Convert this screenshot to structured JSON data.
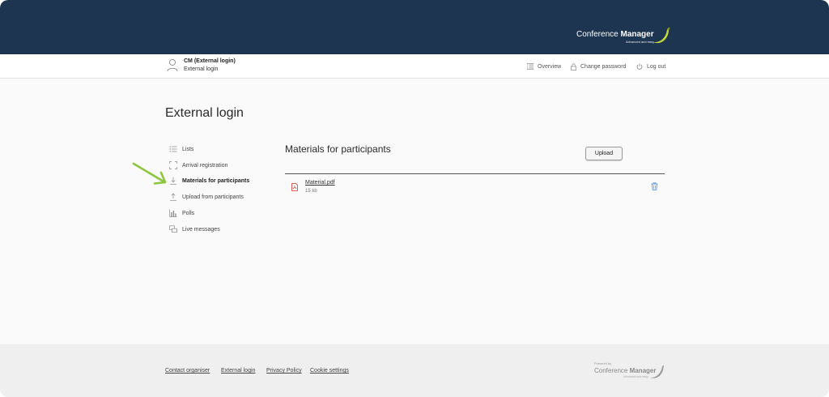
{
  "brand": {
    "name_light": "Conference ",
    "name_bold": "Manager",
    "tagline": "Advanced and easy",
    "accent_color": "#c3d63a"
  },
  "user": {
    "name": "CM (External login)",
    "role": "External login"
  },
  "topnav": {
    "overview": "Overview",
    "change_password": "Change password",
    "logout": "Log out"
  },
  "page": {
    "title": "External login"
  },
  "sidenav": {
    "items": [
      {
        "label": "Lists",
        "icon": "list-icon"
      },
      {
        "label": "Arrival registration",
        "icon": "scan-icon"
      },
      {
        "label": "Materials for participants",
        "icon": "download-icon",
        "active": true
      },
      {
        "label": "Upload from participants",
        "icon": "upload-icon"
      },
      {
        "label": "Polls",
        "icon": "bar-chart-icon"
      },
      {
        "label": "Live messages",
        "icon": "messages-icon"
      }
    ]
  },
  "main": {
    "section_title": "Materials for participants",
    "upload_label": "Upload",
    "files": [
      {
        "name": "Material.pdf",
        "size": "15 kb",
        "icon": "pdf-file-icon"
      }
    ]
  },
  "footer": {
    "links": [
      "Contact organiser",
      "External login",
      "Privacy Policy",
      "Cookie settings"
    ],
    "powered_by": "Powered by",
    "brand_light": "Conference ",
    "brand_bold": "Manager",
    "brand_tagline": "Advanced and easy"
  },
  "colors": {
    "banner": "#1d3550",
    "annotation_arrow": "#8cc63f",
    "pdf_icon": "#d9332b",
    "delete_icon": "#4a90d9"
  }
}
